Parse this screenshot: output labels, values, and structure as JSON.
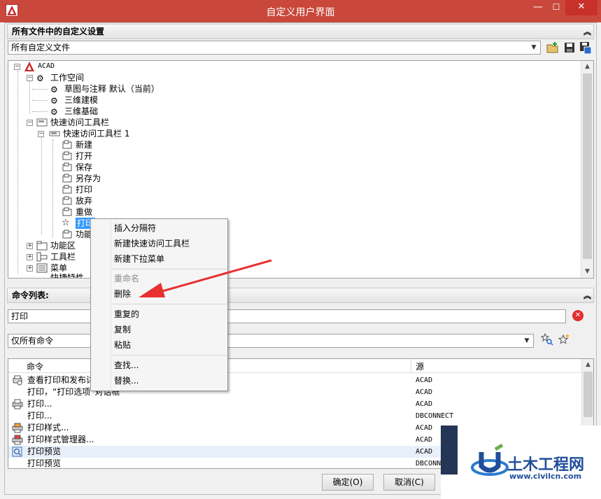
{
  "window": {
    "title": "自定义用户界面",
    "min_glyph": "—",
    "max_glyph": "☐",
    "close_glyph": "✕"
  },
  "customizations_section": {
    "header": "所有文件中的自定义设置",
    "collapse_glyph": "︽",
    "file_combo_value": "所有自定义文件"
  },
  "tree": {
    "root": "ACAD",
    "workspaces": "工作空间",
    "ws_items": [
      "草图与注释 默认（当前）",
      "三维建模",
      "三维基础"
    ],
    "qat_group": "快速访问工具栏",
    "qat1": "快速访问工具栏 1",
    "qat_items": [
      "新建",
      "打开",
      "保存",
      "另存为",
      "打印",
      "放弃",
      "重做",
      "打印",
      "功能"
    ],
    "ribbon": "功能区",
    "toolbars": "工具栏",
    "menus": "菜单",
    "partial": "快捷特性"
  },
  "commands_section": {
    "header": "命令列表:",
    "collapse_glyph": "︽",
    "search_value": "打印",
    "filter_value": "仅所有命令",
    "col_command": "命令",
    "col_source": "源",
    "rows": [
      {
        "name": "查看打印和发布详细信息",
        "src": "ACAD"
      },
      {
        "name": "打印，“打印选项”对话框",
        "src": "ACAD"
      },
      {
        "name": "打印...",
        "src": "ACAD"
      },
      {
        "name": "打印...",
        "src": "DBCONNECT"
      },
      {
        "name": "打印样式...",
        "src": "ACAD"
      },
      {
        "name": "打印样式管理器...",
        "src": "ACAD"
      },
      {
        "name": "打印预览",
        "src": "ACAD"
      },
      {
        "name": "打印预览",
        "src": "DBCONNECT"
      }
    ]
  },
  "context_menu": {
    "items": [
      "插入分隔符",
      "新建快速访问工具栏",
      "新建下拉菜单",
      "重命名",
      "删除",
      "重复的",
      "复制",
      "粘贴",
      "查找...",
      "替换..."
    ]
  },
  "buttons": {
    "ok": "确定(O)",
    "cancel": "取消(C)"
  },
  "watermark": {
    "name": "土木工程网",
    "url": "www.civilcn.com"
  },
  "colors": {
    "titlebar": "#c9483b",
    "close_button": "#c7312a",
    "selection": "#3399ff",
    "arrow": "#e83030"
  }
}
